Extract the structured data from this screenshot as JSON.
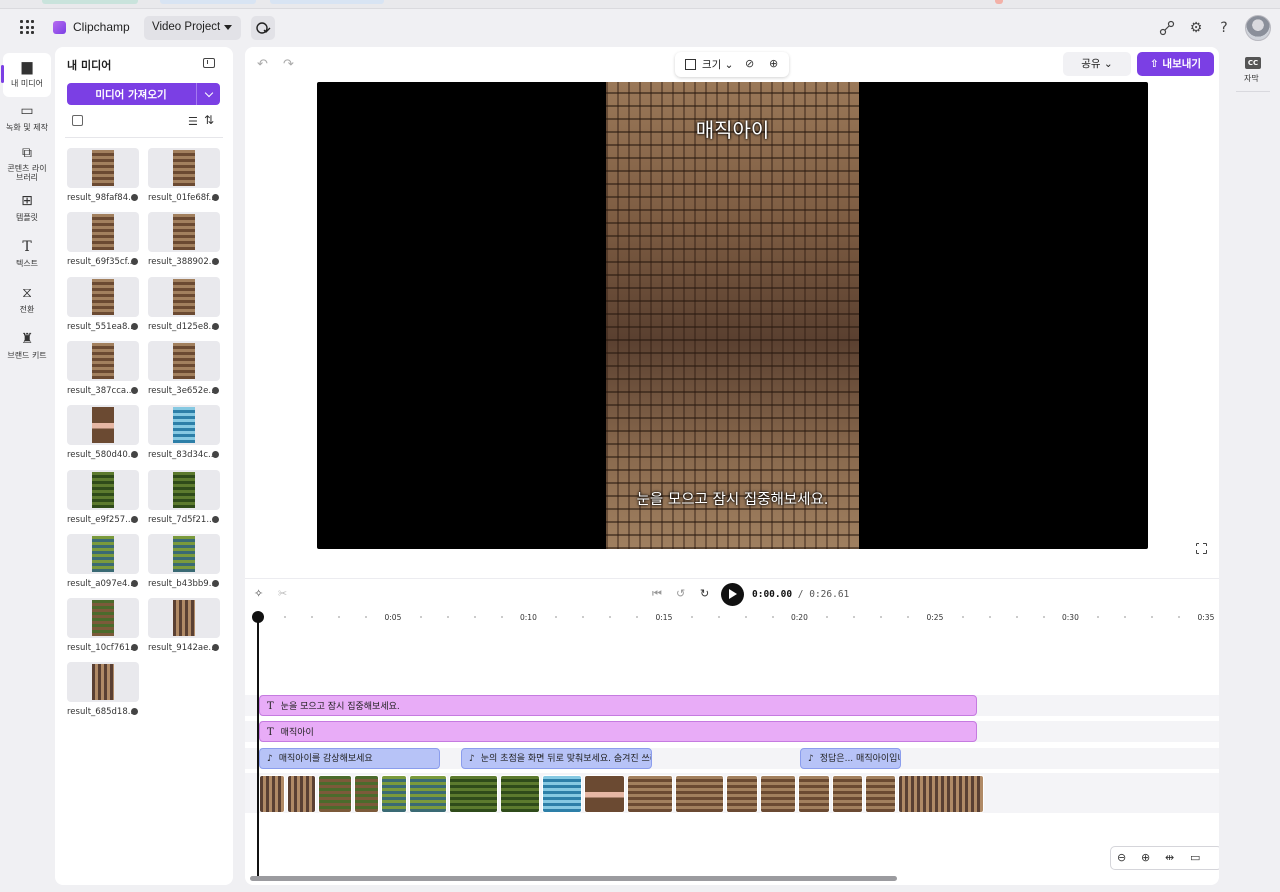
{
  "header": {
    "brand": "Clipchamp",
    "project_name": "Video Project",
    "icons": [
      "waffle-icon",
      "clipchamp-logo",
      "cloud-sync-icon",
      "share-link-icon",
      "gear-icon",
      "help-icon",
      "avatar"
    ]
  },
  "rail": {
    "items": [
      {
        "label": "내 미디어",
        "icon": "folder-icon",
        "active": true
      },
      {
        "label": "녹화 및 제작",
        "icon": "camera-icon"
      },
      {
        "label": "콘텐츠 라이브러리",
        "icon": "library-icon"
      },
      {
        "label": "템플릿",
        "icon": "templates-icon"
      },
      {
        "label": "텍스트",
        "icon": "text-icon"
      },
      {
        "label": "전환",
        "icon": "transition-icon"
      },
      {
        "label": "브랜드 키트",
        "icon": "brand-kit-icon"
      }
    ]
  },
  "media": {
    "title": "내 미디어",
    "import_label": "미디어 가져오기",
    "files": [
      {
        "name": "result_98faf84...",
        "style": "rock"
      },
      {
        "name": "result_01fe68f...",
        "style": "rock"
      },
      {
        "name": "result_69f35cf...",
        "style": "rock"
      },
      {
        "name": "result_388902...",
        "style": "rock"
      },
      {
        "name": "result_551ea8...",
        "style": "rock"
      },
      {
        "name": "result_d125e8...",
        "style": "rock"
      },
      {
        "name": "result_387cca...",
        "style": "rock"
      },
      {
        "name": "result_3e652e...",
        "style": "rock"
      },
      {
        "name": "result_580d40...",
        "style": "mix3"
      },
      {
        "name": "result_83d34c...",
        "style": "sea"
      },
      {
        "name": "result_e9f257...",
        "style": "moss"
      },
      {
        "name": "result_7d5f21...",
        "style": "moss"
      },
      {
        "name": "result_a097e4...",
        "style": "mix1"
      },
      {
        "name": "result_b43bb9...",
        "style": "mix1"
      },
      {
        "name": "result_10cf761...",
        "style": "mix2"
      },
      {
        "name": "result_9142ae...",
        "style": "rockb"
      },
      {
        "name": "result_685d18...",
        "style": "rockb"
      }
    ]
  },
  "editor": {
    "size_label": "크기",
    "share_label": "공유",
    "export_label": "내보내기",
    "subtitle_top": "매직아이",
    "subtitle_bottom": "눈을 모으고 잠시 집중해보세요.",
    "time_current": "0:00.00",
    "time_separator": " / ",
    "time_total": "0:26.61"
  },
  "timeline": {
    "ticks": [
      "0:05",
      "0:10",
      "0:15",
      "0:20",
      "0:25",
      "0:30",
      "0:35"
    ],
    "text_clips": [
      {
        "label": "눈을 모으고 잠시 집중해보세요."
      },
      {
        "label": "매직아이"
      }
    ],
    "audio_clips": [
      {
        "label": "매직아이를 감상해보세요"
      },
      {
        "label": "눈의 초점을 화면 뒤로 맞춰보세요. 숨겨진 쓰러"
      },
      {
        "label": "정답은... 매직아이입니"
      }
    ],
    "video_clip_styles": [
      "rockb",
      "rockb",
      "mix2",
      "mix2",
      "mix1",
      "mix1",
      "moss",
      "moss",
      "sea",
      "mix3",
      "rock",
      "rock",
      "rock",
      "rock",
      "rock",
      "rock",
      "rock",
      "rockb"
    ]
  },
  "right_rail": {
    "caption_icon": "CC",
    "caption_label": "자막"
  }
}
